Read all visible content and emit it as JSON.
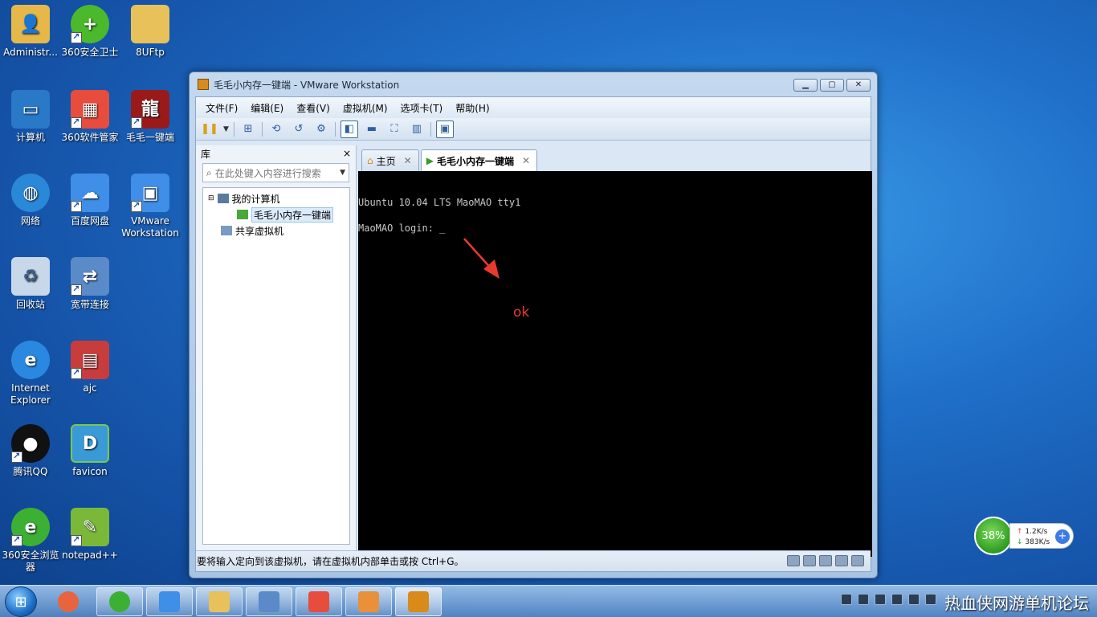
{
  "desktop_icons": [
    {
      "label": "Administr...",
      "icon": "user-folder-icon",
      "color": "#e6b84a"
    },
    {
      "label": "360安全卫士",
      "icon": "360-safe-icon",
      "color": "#4cb82c"
    },
    {
      "label": "8UFtp",
      "icon": "folder-icon",
      "color": "#e8c15a"
    },
    {
      "label": "计算机",
      "icon": "computer-icon",
      "color": "#2a78c8"
    },
    {
      "label": "360软件管家",
      "icon": "360-software-icon",
      "color": "#e84c3c"
    },
    {
      "label": "毛毛一键端",
      "icon": "game-icon",
      "color": "#9a1a1a"
    },
    {
      "label": "网络",
      "icon": "network-icon",
      "color": "#2a88d8"
    },
    {
      "label": "百度网盘",
      "icon": "baidu-cloud-icon",
      "color": "#3f8ee8"
    },
    {
      "label": "VMware Workstation",
      "icon": "vmware-icon",
      "color": "#3f8ee8"
    },
    {
      "label": "回收站",
      "icon": "recycle-bin-icon",
      "color": "#c8d8ea"
    },
    {
      "label": "宽带连接",
      "icon": "broadband-icon",
      "color": "#5a8ac8"
    },
    {
      "label": "Internet Explorer",
      "icon": "ie-icon",
      "color": "#2a88e0"
    },
    {
      "label": "ajc",
      "icon": "archive-icon",
      "color": "#c83c3c"
    },
    {
      "label": "腾讯QQ",
      "icon": "qq-icon",
      "color": "#111111"
    },
    {
      "label": "favicon",
      "icon": "favicon-icon",
      "color": "#3a9ad8"
    },
    {
      "label": "360安全浏览器",
      "icon": "360-browser-icon",
      "color": "#3cb034"
    },
    {
      "label": "notepad++",
      "icon": "notepad-plus-icon",
      "color": "#7ab83a"
    }
  ],
  "window": {
    "title": "毛毛小内存一键端 - VMware Workstation",
    "menu": [
      "文件(F)",
      "编辑(E)",
      "查看(V)",
      "虚拟机(M)",
      "选项卡(T)",
      "帮助(H)"
    ],
    "library": {
      "title": "库",
      "close": "×",
      "search_placeholder": "在此处键入内容进行搜索",
      "tree": {
        "my_computer": "我的计算机",
        "vm": "毛毛小内存一键端",
        "shared": "共享虚拟机"
      }
    },
    "tabs": [
      {
        "label": "主页"
      },
      {
        "label": "毛毛小内存一键端"
      }
    ],
    "console": {
      "line1": "Ubuntu 10.04 LTS MaoMAO tty1",
      "line2": "MaoMAO login: _",
      "annotation": "ok"
    },
    "status": "要将输入定向到该虚拟机，请在虚拟机内部单击或按 Ctrl+G。"
  },
  "net_widget": {
    "percent": "38%",
    "upload": "1.2K/s",
    "download": "383K/s"
  },
  "taskbar": {
    "apps": [
      "360-software-icon",
      "360-browser-icon",
      "baidu-cloud-icon",
      "explorer-icon",
      "control-panel-icon",
      "360-software-icon",
      "media-player-icon",
      "vmware-icon"
    ]
  },
  "watermark": "热血侠网游单机论坛"
}
